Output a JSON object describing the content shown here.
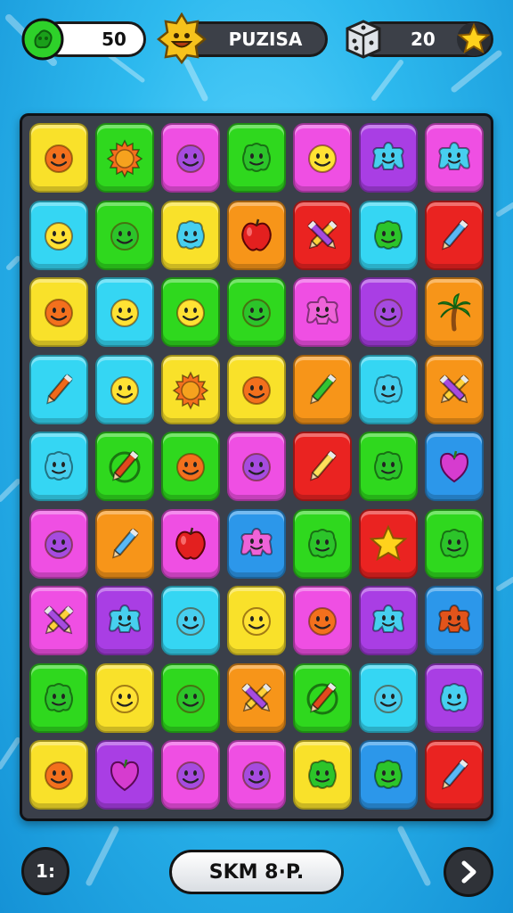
{
  "hud": {
    "coins": {
      "icon": "green-gem-icon",
      "value": "50"
    },
    "player": {
      "icon": "smiling-mascot-icon",
      "name": "PUZISA"
    },
    "moves": {
      "icon": "dice-icon",
      "value": "20",
      "star_icon": "star-icon"
    }
  },
  "colors": {
    "yellow": "#f9e12a",
    "green": "#2fd81e",
    "magenta": "#ef4fe3",
    "cyan": "#35d6f3",
    "blue": "#2c97ea",
    "orange": "#f79519",
    "red": "#ea2321",
    "purple": "#a93ee4",
    "teal": "#2fe6d6"
  },
  "board": {
    "rows": [
      [
        {
          "bg": "yellow",
          "icon": "orange-smiley-icon"
        },
        {
          "bg": "green",
          "icon": "orange-sun-icon"
        },
        {
          "bg": "magenta",
          "icon": "purple-smiley-icon"
        },
        {
          "bg": "green",
          "icon": "green-blob-icon"
        },
        {
          "bg": "magenta",
          "icon": "yellow-smiley-icon"
        },
        {
          "bg": "purple",
          "icon": "cyan-star-blob-icon"
        },
        {
          "bg": "magenta",
          "icon": "cyan-star-blob-icon"
        }
      ],
      [
        {
          "bg": "cyan",
          "icon": "yellow-smiley-icon"
        },
        {
          "bg": "green",
          "icon": "green-smiley-icon"
        },
        {
          "bg": "yellow",
          "icon": "cyan-blob-icon"
        },
        {
          "bg": "orange",
          "icon": "red-apple-icon"
        },
        {
          "bg": "red",
          "icon": "crossed-pencils-icon"
        },
        {
          "bg": "cyan",
          "icon": "green-blob-icon"
        },
        {
          "bg": "red",
          "icon": "blue-pencil-icon"
        }
      ],
      [
        {
          "bg": "yellow",
          "icon": "orange-smiley-icon"
        },
        {
          "bg": "cyan",
          "icon": "yellow-smiley-icon"
        },
        {
          "bg": "green",
          "icon": "yellow-smiley-icon"
        },
        {
          "bg": "green",
          "icon": "green-smiley-icon"
        },
        {
          "bg": "magenta",
          "icon": "pink-star-blob-icon"
        },
        {
          "bg": "purple",
          "icon": "purple-smiley-icon"
        },
        {
          "bg": "orange",
          "icon": "palm-tree-icon"
        }
      ],
      [
        {
          "bg": "cyan",
          "icon": "orange-pencil-icon"
        },
        {
          "bg": "cyan",
          "icon": "yellow-smiley-icon"
        },
        {
          "bg": "yellow",
          "icon": "orange-sun-icon"
        },
        {
          "bg": "yellow",
          "icon": "orange-smiley-icon"
        },
        {
          "bg": "orange",
          "icon": "green-pencil-icon"
        },
        {
          "bg": "cyan",
          "icon": "cyan-blob-icon"
        },
        {
          "bg": "orange",
          "icon": "crossed-pencils-icon"
        }
      ],
      [
        {
          "bg": "cyan",
          "icon": "cyan-blob-icon"
        },
        {
          "bg": "green",
          "icon": "pencil-circle-icon"
        },
        {
          "bg": "green",
          "icon": "orange-smiley-icon"
        },
        {
          "bg": "magenta",
          "icon": "purple-smiley-icon"
        },
        {
          "bg": "red",
          "icon": "yellow-pencil-icon"
        },
        {
          "bg": "green",
          "icon": "green-blob-icon"
        },
        {
          "bg": "blue",
          "icon": "magenta-heart-icon"
        }
      ],
      [
        {
          "bg": "magenta",
          "icon": "purple-smiley-icon"
        },
        {
          "bg": "orange",
          "icon": "blue-pencil-icon"
        },
        {
          "bg": "magenta",
          "icon": "red-apple-icon"
        },
        {
          "bg": "blue",
          "icon": "pink-star-blob-icon"
        },
        {
          "bg": "green",
          "icon": "green-blob-icon"
        },
        {
          "bg": "red",
          "icon": "yellow-star-icon"
        },
        {
          "bg": "green",
          "icon": "green-blob-icon"
        }
      ],
      [
        {
          "bg": "magenta",
          "icon": "crossed-pencils-icon"
        },
        {
          "bg": "purple",
          "icon": "cyan-star-blob-icon"
        },
        {
          "bg": "cyan",
          "icon": "cyan-smiley-icon"
        },
        {
          "bg": "yellow",
          "icon": "yellow-smiley-icon"
        },
        {
          "bg": "magenta",
          "icon": "orange-smiley-icon"
        },
        {
          "bg": "purple",
          "icon": "cyan-star-blob-icon"
        },
        {
          "bg": "blue",
          "icon": "orange-star-blob-icon"
        }
      ],
      [
        {
          "bg": "green",
          "icon": "green-blob-icon"
        },
        {
          "bg": "yellow",
          "icon": "yellow-smiley-icon"
        },
        {
          "bg": "green",
          "icon": "green-smiley-icon"
        },
        {
          "bg": "orange",
          "icon": "crossed-pencils-icon"
        },
        {
          "bg": "green",
          "icon": "pencil-circle-icon"
        },
        {
          "bg": "cyan",
          "icon": "cyan-smiley-icon"
        },
        {
          "bg": "purple",
          "icon": "cyan-blob-icon"
        }
      ],
      [
        {
          "bg": "yellow",
          "icon": "orange-smiley-icon"
        },
        {
          "bg": "purple",
          "icon": "magenta-heart-icon"
        },
        {
          "bg": "magenta",
          "icon": "purple-smiley-icon"
        },
        {
          "bg": "magenta",
          "icon": "purple-smiley-icon"
        },
        {
          "bg": "yellow",
          "icon": "green-blob-icon"
        },
        {
          "bg": "blue",
          "icon": "green-blob-icon"
        },
        {
          "bg": "red",
          "icon": "blue-pencil-icon"
        }
      ]
    ]
  },
  "footer": {
    "left_label": "1:",
    "center_label": "SKM 8·P.",
    "right_icon": "chevron-right-icon"
  }
}
